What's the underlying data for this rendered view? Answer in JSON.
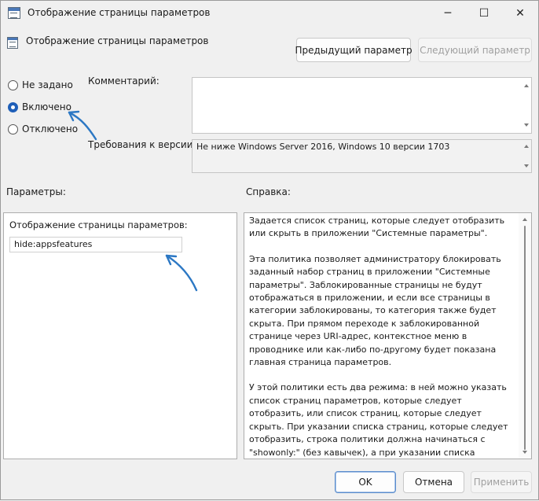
{
  "window": {
    "title": "Отображение страницы параметров",
    "controls": {
      "minimize": "─",
      "maximize": "☐",
      "close": "✕"
    }
  },
  "policy": {
    "title": "Отображение страницы параметров"
  },
  "nav": {
    "prev_label": "Предыдущий параметр",
    "next_label": "Следующий параметр"
  },
  "state": {
    "options": [
      {
        "label": "Не задано",
        "checked": false
      },
      {
        "label": "Включено",
        "checked": true
      },
      {
        "label": "Отключено",
        "checked": false
      }
    ]
  },
  "comment": {
    "label": "Комментарий:",
    "value": ""
  },
  "requirements": {
    "label": "Требования к версии:",
    "value": "Не ниже Windows Server 2016, Windows 10 версии 1703"
  },
  "options_section": {
    "header": "Параметры:",
    "field_label": "Отображение страницы параметров:",
    "field_value": "hide:appsfeatures"
  },
  "help": {
    "header": "Справка:",
    "paragraphs": [
      "Задается список страниц, которые следует отобразить или скрыть в приложении \"Системные параметры\".",
      "Эта политика позволяет администратору блокировать заданный набор страниц в приложении \"Системные параметры\". Заблокированные страницы не будут отображаться в приложении, и если все страницы в категории заблокированы, то категория также будет скрыта. При прямом переходе к заблокированной странице через URI-адрес, контекстное меню в проводнике или как-либо по-другому будет показана главная страница параметров.",
      "У этой политики есть два режима: в ней можно указать список страниц параметров, которые следует отобразить, или список страниц, которые следует скрыть. При указании списка страниц, которые следует отобразить, строка политики должна начинаться с \"showonly:\" (без кавычек), а при указании списка страниц, которые следует скрыть, — с \"hide:\". Если страница из списка showonly в обычной ситуации была бы скрыта по другим причинам (например, из-за отсутствия устройства), данная политика не будет"
    ]
  },
  "footer": {
    "ok_label": "OK",
    "cancel_label": "Отмена",
    "apply_label": "Применить"
  },
  "colors": {
    "accent": "#1f5fb8",
    "annotation_arrow": "#2c78c4",
    "background": "#f0f0f0"
  }
}
